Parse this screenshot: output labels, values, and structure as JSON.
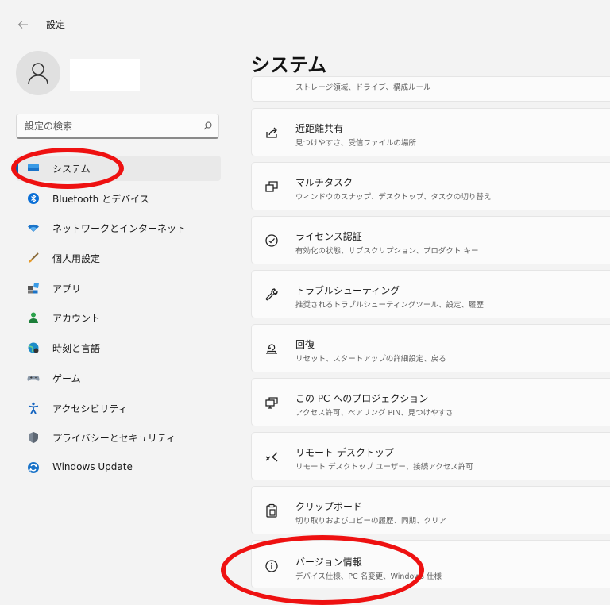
{
  "window": {
    "back_icon": "arrow-left-icon",
    "title": "設定"
  },
  "user": {
    "avatar_icon": "person-icon"
  },
  "search": {
    "placeholder": "設定の検索",
    "icon": "search-icon"
  },
  "sidebar": {
    "items": [
      {
        "label": "システム",
        "icon": "monitor-icon",
        "selected": true
      },
      {
        "label": "Bluetooth とデバイス",
        "icon": "bluetooth-icon"
      },
      {
        "label": "ネットワークとインターネット",
        "icon": "wifi-icon"
      },
      {
        "label": "個人用設定",
        "icon": "brush-icon"
      },
      {
        "label": "アプリ",
        "icon": "apps-icon"
      },
      {
        "label": "アカウント",
        "icon": "account-icon"
      },
      {
        "label": "時刻と言語",
        "icon": "globe-clock-icon"
      },
      {
        "label": "ゲーム",
        "icon": "gamepad-icon"
      },
      {
        "label": "アクセシビリティ",
        "icon": "accessibility-icon"
      },
      {
        "label": "プライバシーとセキュリティ",
        "icon": "shield-icon"
      },
      {
        "label": "Windows Update",
        "icon": "update-icon"
      }
    ]
  },
  "main": {
    "title": "システム",
    "partial_card_subtitle": "ストレージ領域、ドライブ、構成ルール",
    "cards": [
      {
        "title": "近距離共有",
        "subtitle": "見つけやすさ、受信ファイルの場所",
        "icon": "share-icon"
      },
      {
        "title": "マルチタスク",
        "subtitle": "ウィンドウのスナップ、デスクトップ、タスクの切り替え",
        "icon": "multitask-icon"
      },
      {
        "title": "ライセンス認証",
        "subtitle": "有効化の状態、サブスクリプション、プロダクト キー",
        "icon": "check-circle-icon"
      },
      {
        "title": "トラブルシューティング",
        "subtitle": "推奨されるトラブルシューティングツール、設定、履歴",
        "icon": "wrench-icon"
      },
      {
        "title": "回復",
        "subtitle": "リセット、スタートアップの詳細設定、戻る",
        "icon": "recovery-icon"
      },
      {
        "title": "この PC へのプロジェクション",
        "subtitle": "アクセス許可、ペアリング PIN、見つけやすさ",
        "icon": "projection-icon"
      },
      {
        "title": "リモート デスクトップ",
        "subtitle": "リモート デスクトップ ユーザー、接続アクセス許可",
        "icon": "remote-desktop-icon"
      },
      {
        "title": "クリップボード",
        "subtitle": "切り取りおよびコピーの履歴、同期、クリア",
        "icon": "clipboard-icon"
      },
      {
        "title": "バージョン情報",
        "subtitle": "デバイス仕様、PC 名変更、Windows 仕様",
        "icon": "info-icon"
      }
    ]
  },
  "annotations": {
    "ring_color": "#ee1111"
  }
}
